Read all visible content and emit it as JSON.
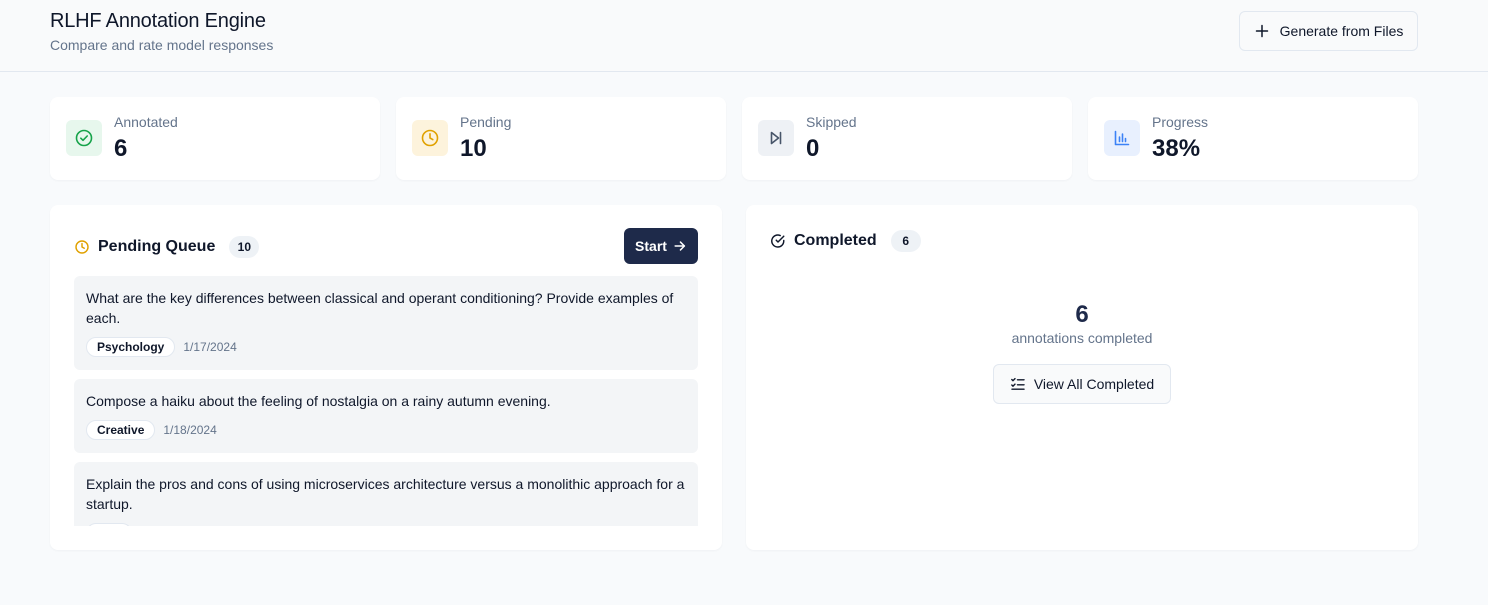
{
  "header": {
    "title": "RLHF Annotation Engine",
    "subtitle": "Compare and rate model responses",
    "generate_button": "Generate from Files"
  },
  "stats": [
    {
      "label": "Annotated",
      "value": "6",
      "icon": "check-circle-icon",
      "color": "#16a34a",
      "bg": "#e7f7ed"
    },
    {
      "label": "Pending",
      "value": "10",
      "icon": "clock-icon",
      "color": "#e0a100",
      "bg": "#fdf3dc"
    },
    {
      "label": "Skipped",
      "value": "0",
      "icon": "skip-forward-icon",
      "color": "#475569",
      "bg": "#eef1f5"
    },
    {
      "label": "Progress",
      "value": "38%",
      "icon": "bar-chart-icon",
      "color": "#3b82f6",
      "bg": "#e8f0fe"
    }
  ],
  "pending": {
    "title": "Pending Queue",
    "count": "10",
    "start_label": "Start",
    "items": [
      {
        "text": "What are the key differences between classical and operant conditioning? Provide examples of each.",
        "tag": "Psychology",
        "date": "1/17/2024"
      },
      {
        "text": "Compose a haiku about the feeling of nostalgia on a rainy autumn evening.",
        "tag": "Creative",
        "date": "1/18/2024"
      },
      {
        "text": "Explain the pros and cons of using microservices architecture versus a monolithic approach for a startup.",
        "tag": "",
        "date": ""
      }
    ]
  },
  "completed": {
    "title": "Completed",
    "count": "6",
    "big_number": "6",
    "caption": "annotations completed",
    "view_all_label": "View All Completed"
  },
  "colors": {
    "accent_dark": "#1e2a4a",
    "pending": "#e0a100",
    "annotated": "#16a34a",
    "progress": "#3b82f6"
  }
}
